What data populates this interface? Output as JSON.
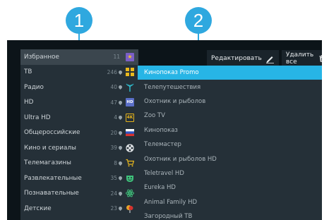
{
  "markers": {
    "first": "1",
    "second": "2"
  },
  "toolbar": {
    "edit_label": "Редактировать",
    "delete_all_label": "Удалить все"
  },
  "categories": [
    {
      "label": "Избранное",
      "count": "11",
      "icon": "star-icon",
      "color": "#7b5fc7"
    },
    {
      "label": "ТВ",
      "count": "246",
      "icon": "grid-icon",
      "color": "#e9b81d"
    },
    {
      "label": "Радио",
      "count": "40",
      "icon": "antenna-icon",
      "color": "#2fb8c9"
    },
    {
      "label": "HD",
      "count": "47",
      "icon": "hd-icon",
      "color": "#5b6fc7"
    },
    {
      "label": "Ultra HD",
      "count": "4",
      "icon": "4k-icon",
      "color": "#e4b21c"
    },
    {
      "label": "Общероссийские",
      "count": "20",
      "icon": "flag-icon",
      "color": "#d6332f"
    },
    {
      "label": "Кино и сериалы",
      "count": "39",
      "icon": "film-reel-icon",
      "color": "#dfe3e6"
    },
    {
      "label": "Телемагазины",
      "count": "8",
      "icon": "cart-icon",
      "color": "#e9b81d"
    },
    {
      "label": "Развлекательные",
      "count": "35",
      "icon": "mask-icon",
      "color": "#3fc37b"
    },
    {
      "label": "Познавательные",
      "count": "24",
      "icon": "atom-icon",
      "color": "#3fc37b"
    },
    {
      "label": "Детские",
      "count": "23",
      "icon": "balloon-icon",
      "color": "#e7a52a"
    }
  ],
  "channels": [
    "Кинопоказ Promo",
    "Телепутешествия",
    "Охотник и рыболов",
    "Zoo TV",
    "Кинопоказ",
    "Телемастер",
    "Охотник и рыболов HD",
    "Teletravel HD",
    "Eureka HD",
    "Animal Family HD",
    "Загородный ТВ"
  ],
  "ui": {
    "ultra_hd_badge": "4K",
    "hd_badge": "HD"
  }
}
